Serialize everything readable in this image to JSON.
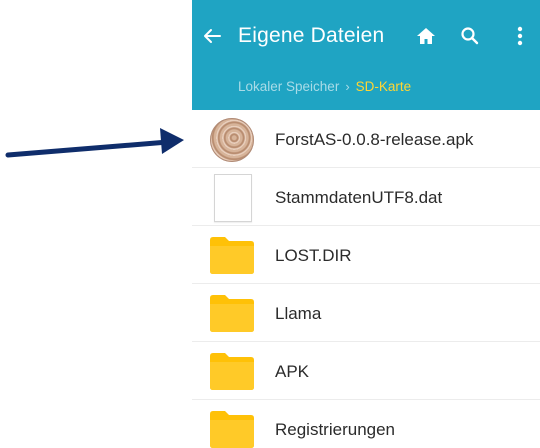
{
  "header": {
    "title": "Eigene Dateien",
    "breadcrumb": [
      "Lokaler Speicher",
      "SD-Karte"
    ],
    "breadcrumb_separator": "›"
  },
  "icons": {
    "back": "arrow-left-icon",
    "home": "home-icon",
    "search": "search-icon",
    "more": "more-vertical-icon",
    "annotation": "arrow-right-icon"
  },
  "colors": {
    "appbar": "#1fa4c3",
    "breadcrumb_active": "#ffd633",
    "folder": "#ffc107",
    "annotation_arrow": "#0f2d6b"
  },
  "files": [
    {
      "name": "ForstAS-0.0.8-release.apk",
      "type": "apk"
    },
    {
      "name": "StammdatenUTF8.dat",
      "type": "file"
    },
    {
      "name": "LOST.DIR",
      "type": "folder"
    },
    {
      "name": "Llama",
      "type": "folder"
    },
    {
      "name": "APK",
      "type": "folder"
    },
    {
      "name": "Registrierungen",
      "type": "folder"
    }
  ]
}
